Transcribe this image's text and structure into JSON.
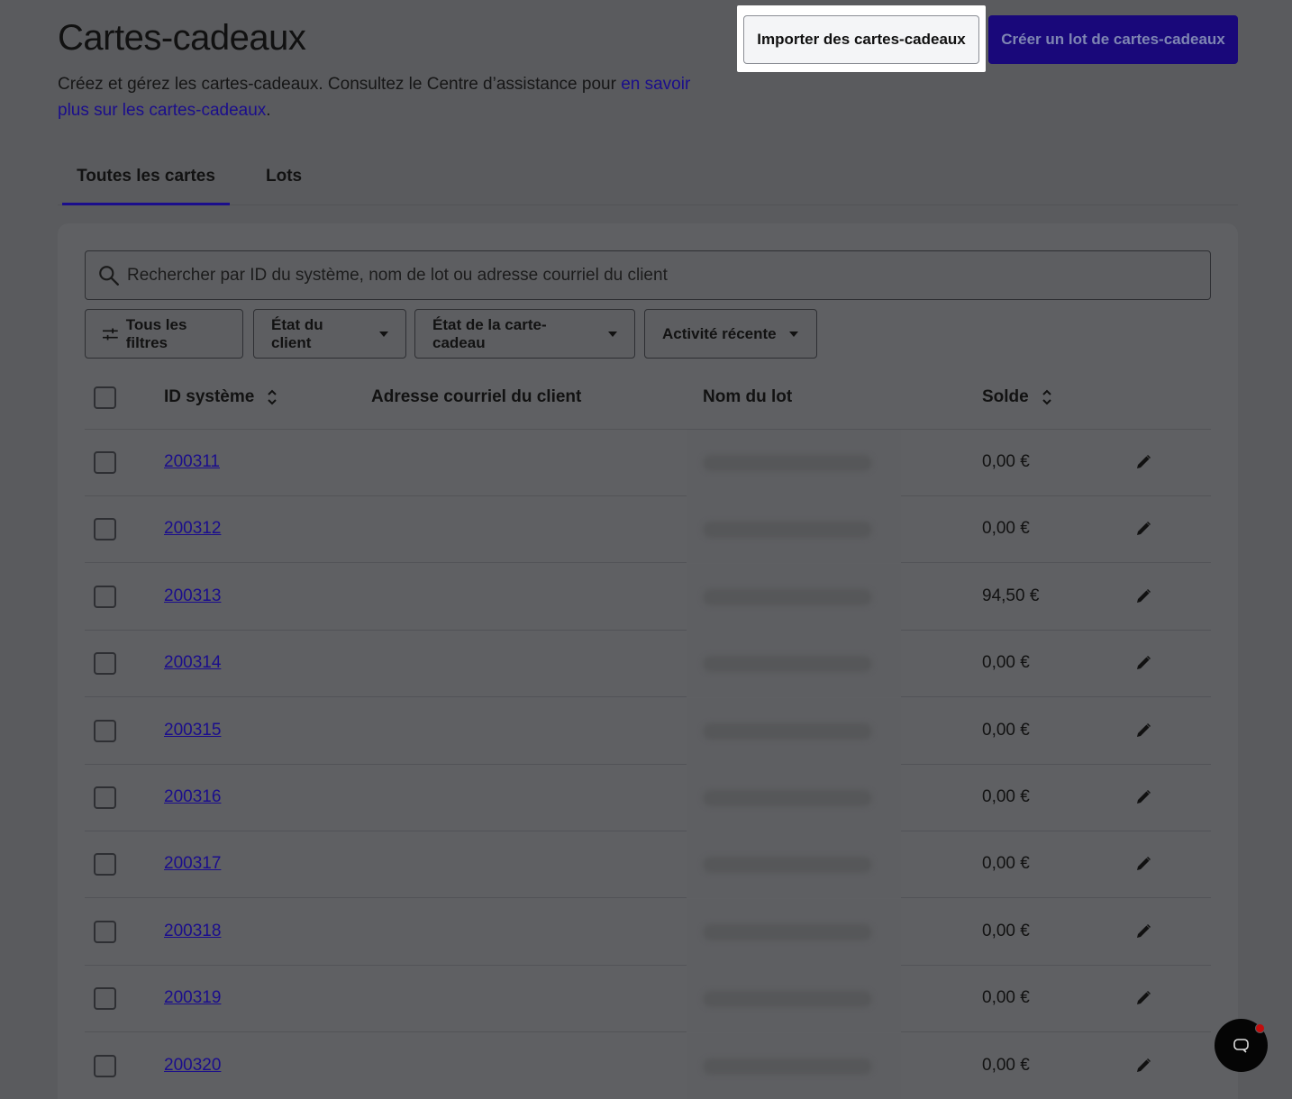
{
  "page": {
    "title": "Cartes-cadeaux",
    "subtitle_prefix": "Créez et gérez les cartes-cadeaux. Consultez le Centre d’assistance pour ",
    "subtitle_link": "en savoir plus sur les cartes-cadeaux",
    "subtitle_suffix": "."
  },
  "actions": {
    "import_label": "Importer des cartes-cadeaux",
    "create_label": "Créer un lot de cartes-cadeaux"
  },
  "tabs": [
    {
      "label": "Toutes les cartes",
      "active": true
    },
    {
      "label": "Lots",
      "active": false
    }
  ],
  "search": {
    "placeholder": "Rechercher par ID du système, nom de lot ou adresse courriel du client",
    "value": ""
  },
  "filters": {
    "all": "Tous les filtres",
    "customer_state": "État du client",
    "card_state": "État de la carte-cadeau",
    "recent_activity": "Activité récente"
  },
  "table": {
    "columns": {
      "system_id": "ID système",
      "email": "Adresse courriel du client",
      "batch_name": "Nom du lot",
      "balance": "Solde"
    },
    "rows": [
      {
        "id": "200311",
        "balance": "0,00 €"
      },
      {
        "id": "200312",
        "balance": "0,00 €"
      },
      {
        "id": "200313",
        "balance": "94,50 €"
      },
      {
        "id": "200314",
        "balance": "0,00 €"
      },
      {
        "id": "200315",
        "balance": "0,00 €"
      },
      {
        "id": "200316",
        "balance": "0,00 €"
      },
      {
        "id": "200317",
        "balance": "0,00 €"
      },
      {
        "id": "200318",
        "balance": "0,00 €"
      },
      {
        "id": "200319",
        "balance": "0,00 €"
      },
      {
        "id": "200320",
        "balance": "0,00 €"
      }
    ]
  },
  "icons": {
    "search": "search-icon",
    "filters": "sliders-icon",
    "sort": "sort-icon",
    "edit": "pencil-icon",
    "chat": "chat-icon"
  },
  "colors": {
    "accent": "#1b0e8c",
    "overlay": "#5a5b5e",
    "notification": "#c20d0d"
  }
}
